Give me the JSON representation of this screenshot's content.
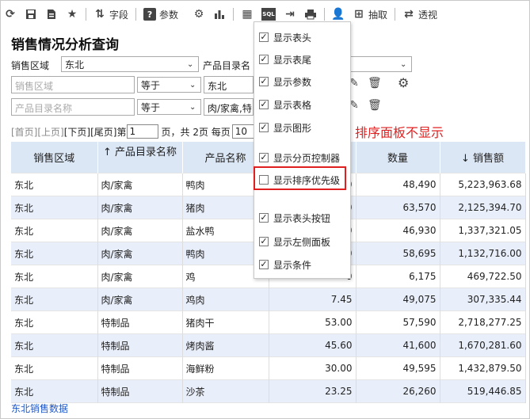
{
  "toolbar": {
    "fields_label": "字段",
    "params_label": "参数",
    "extract_label": "抽取",
    "pivot_label": "透视"
  },
  "page_title": "销售情况分析查询",
  "filters": {
    "region_label": "销售区域",
    "region_value": "东北",
    "catalog_label": "产品目录名",
    "cond1_field_placeholder": "销售区域",
    "cond1_op": "等于",
    "cond1_value": "东北",
    "cond2_field_placeholder": "产品目录名称",
    "cond2_op": "等于",
    "cond2_value": "肉/家禽,特"
  },
  "pager": {
    "first": "[首页]",
    "prev": "[上页]",
    "next": "[下页]",
    "last": "[尾页]",
    "page_prefix": "第",
    "page_value": "1",
    "page_suffix": "页，共 2页 每页",
    "page_size": "10"
  },
  "annotation": "排序面板不显示",
  "table": {
    "headers": [
      "销售区域",
      "↑ 产品目录名称",
      "产品名称",
      "",
      "数量",
      "↓ 销售额"
    ],
    "rows": [
      [
        "东北",
        "肉/家禽",
        "鸭肉",
        "",
        "48,490",
        "5,223,963.68"
      ],
      [
        "东北",
        "肉/家禽",
        "猪肉",
        "",
        "63,570",
        "2,125,394.70"
      ],
      [
        "东北",
        "肉/家禽",
        "盐水鸭",
        "",
        "46,930",
        "1,337,321.05"
      ],
      [
        "东北",
        "肉/家禽",
        "鸭肉",
        "",
        "58,695",
        "1,132,716.00"
      ],
      [
        "东北",
        "肉/家禽",
        "鸡",
        "",
        "6,175",
        "469,722.50"
      ],
      [
        "东北",
        "肉/家禽",
        "鸡肉",
        "7.45",
        "49,075",
        "307,335.44"
      ],
      [
        "东北",
        "特制品",
        "猪肉干",
        "53.00",
        "57,590",
        "2,718,277.25"
      ],
      [
        "东北",
        "特制品",
        "烤肉酱",
        "45.60",
        "41,600",
        "1,670,281.60"
      ],
      [
        "东北",
        "特制品",
        "海鲜粉",
        "30.00",
        "49,595",
        "1,432,879.50"
      ],
      [
        "东北",
        "特制品",
        "沙茶",
        "23.25",
        "26,260",
        "519,446.85"
      ]
    ],
    "partial_price_digits": [
      "0",
      "0",
      "0",
      "0",
      "0"
    ]
  },
  "footer_link": "东北销售数据",
  "menu": {
    "items": [
      {
        "label": "显示表头",
        "checked": true
      },
      {
        "label": "显示表尾",
        "checked": true
      },
      {
        "label": "显示参数",
        "checked": true
      },
      {
        "label": "显示表格",
        "checked": true
      },
      {
        "label": "显示图形",
        "checked": true
      },
      {
        "label": "显示分页控制器",
        "checked": true
      },
      {
        "label": "显示排序优先级",
        "checked": false
      },
      {
        "label": "显示表头按钮",
        "checked": true
      },
      {
        "label": "显示左侧面板",
        "checked": true
      },
      {
        "label": "显示条件",
        "checked": true
      }
    ]
  },
  "colors": {
    "header_bg": "#dce7f5",
    "stripe_bg": "#e9effa",
    "annotation": "#e02020",
    "link": "#1f57c6"
  }
}
